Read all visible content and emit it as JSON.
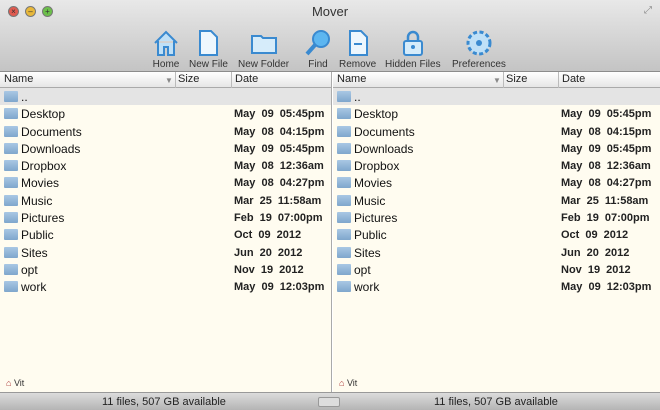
{
  "window": {
    "title": "Mover"
  },
  "toolbar": [
    {
      "label": "Home",
      "icon": "home-icon"
    },
    {
      "label": "New File",
      "icon": "new-file-icon"
    },
    {
      "label": "New Folder",
      "icon": "new-folder-icon"
    },
    {
      "label": "Find",
      "icon": "magnifier-icon"
    },
    {
      "label": "Remove",
      "icon": "remove-file-icon"
    },
    {
      "label": "Hidden Files",
      "icon": "lock-icon"
    },
    {
      "label": "Preferences",
      "icon": "gear-icon"
    }
  ],
  "columns": {
    "name": "Name",
    "size": "Size",
    "date": "Date"
  },
  "files": [
    {
      "name": "..",
      "date": ""
    },
    {
      "name": "Desktop",
      "date": "May 09  05:45pm"
    },
    {
      "name": "Documents",
      "date": "May 08  04:15pm"
    },
    {
      "name": "Downloads",
      "date": "May 09  05:45pm"
    },
    {
      "name": "Dropbox",
      "date": "May 08  12:36am"
    },
    {
      "name": "Movies",
      "date": "May 08  04:27pm"
    },
    {
      "name": "Music",
      "date": "Mar 25  11:58am"
    },
    {
      "name": "Pictures",
      "date": "Feb 19  07:00pm"
    },
    {
      "name": "Public",
      "date": "Oct 09  2012"
    },
    {
      "name": "Sites",
      "date": "Jun 20  2012"
    },
    {
      "name": "opt",
      "date": "Nov 19  2012"
    },
    {
      "name": "work",
      "date": "May 09  12:03pm"
    }
  ],
  "left": {
    "breadcrumb": "Vit",
    "status": "11 files, 507 GB available"
  },
  "right": {
    "breadcrumb": "Vit",
    "status": "11 files, 507 GB available"
  }
}
